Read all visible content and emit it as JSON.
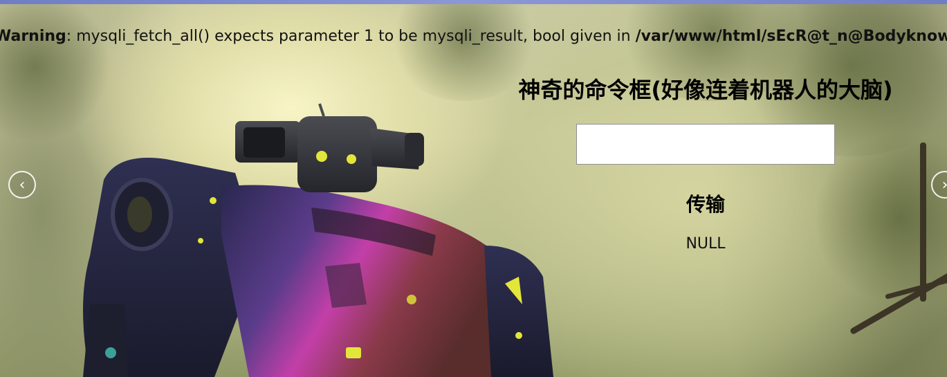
{
  "warning": {
    "label": "Warning",
    "message": ": mysqli_fetch_all() expects parameter 1 to be mysqli_result, bool given in ",
    "path": "/var/www/html/sEcR@t_n@Bodyknow"
  },
  "panel": {
    "title": "神奇的命令框(好像连着机器人的大脑)",
    "input_value": "",
    "submit_label": "传输",
    "result_text": "NULL"
  },
  "carousel": {
    "prev_icon": "chevron-left-icon",
    "next_icon": "chevron-right-icon",
    "prev_glyph": "‹",
    "next_glyph": "›"
  },
  "colors": {
    "robot_body": "#5a3c8a",
    "robot_accent": "#c23fa8",
    "robot_eyes": "#e3e63a"
  }
}
